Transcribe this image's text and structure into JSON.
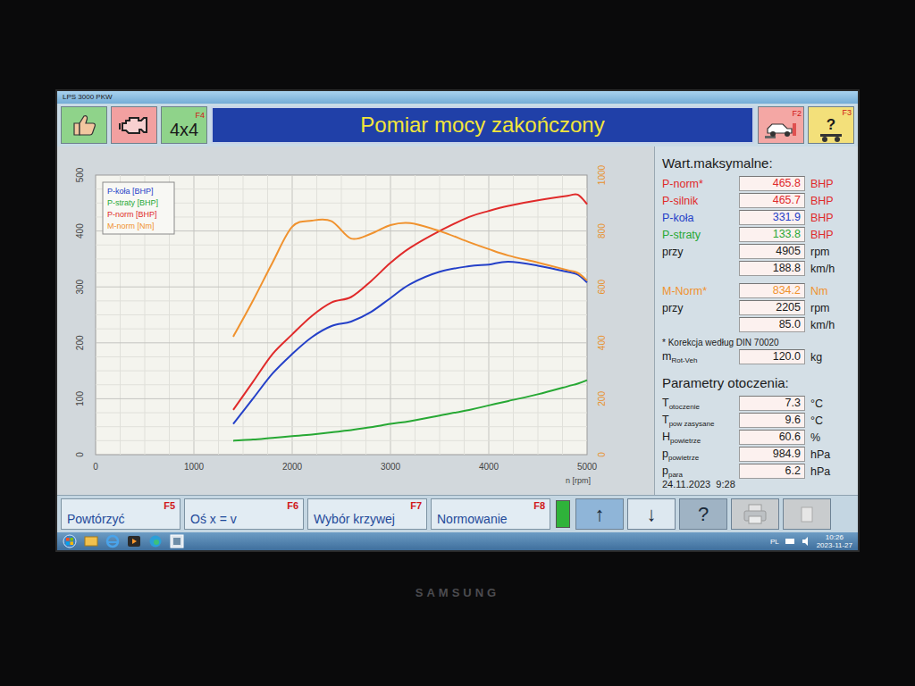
{
  "monitor": {
    "brand": "SAMSUNG"
  },
  "window": {
    "title": "LPS 3000 PKW"
  },
  "toolbar": {
    "left_buttons": [
      {
        "kind": "thumbs-up",
        "color": "#8fd38a"
      },
      {
        "kind": "engine",
        "color": "#f2a0a0"
      },
      {
        "kind": "text",
        "text": "4x4",
        "key": "F4",
        "color": "#8fd38a"
      }
    ],
    "title": "Pomiar mocy zakończony",
    "right_buttons": [
      {
        "kind": "car",
        "key": "F2",
        "color": "#f4a7a4"
      },
      {
        "kind": "help",
        "glyph": "?",
        "key": "F3",
        "color": "#f3e07a"
      }
    ]
  },
  "chart": {
    "x_ticks": [
      "0",
      "1000",
      "2000",
      "3000",
      "4000",
      "5000"
    ],
    "x_unit": "n [rpm]",
    "left_ticks": [
      "0",
      "100",
      "200",
      "300",
      "400",
      "500"
    ],
    "right_ticks": [
      "0",
      "200",
      "400",
      "600",
      "800",
      "1000"
    ],
    "rpm": [
      1400,
      1600,
      1800,
      2000,
      2200,
      2400,
      2600,
      2800,
      3000,
      3200,
      3500,
      3800,
      4000,
      4200,
      4500,
      4800,
      4905,
      5000
    ],
    "series": [
      {
        "label": "P-koła [BHP]",
        "color": "#2440c8",
        "axis": "left",
        "values": [
          55,
          100,
          145,
          180,
          210,
          230,
          238,
          255,
          280,
          305,
          327,
          337,
          340,
          345,
          338,
          327,
          322,
          308
        ]
      },
      {
        "label": "P-straty [BHP]",
        "color": "#27a834",
        "axis": "left",
        "values": [
          25,
          27,
          30,
          33,
          36,
          40,
          44,
          49,
          55,
          60,
          70,
          80,
          88,
          96,
          108,
          122,
          127,
          133
        ]
      },
      {
        "label": "P-norm [BHP]",
        "color": "#e02a2a",
        "axis": "left",
        "values": [
          80,
          130,
          180,
          215,
          248,
          272,
          282,
          310,
          343,
          370,
          400,
          425,
          436,
          445,
          455,
          463,
          465,
          448
        ]
      },
      {
        "label": "M-norm [Nm]",
        "color": "#f0922e",
        "axis": "right",
        "values": [
          422,
          550,
          687,
          815,
          837,
          835,
          773,
          790,
          821,
          828,
          800,
          760,
          735,
          712,
          687,
          660,
          650,
          623
        ]
      }
    ]
  },
  "max_values": {
    "title": "Wart.maksymalne:",
    "power_rows": [
      {
        "label": "P-norm*",
        "value": "465.8",
        "unit": "BHP",
        "color": "#e02a2a",
        "unit_color": "#e02a2a"
      },
      {
        "label": "P-silnik",
        "value": "465.7",
        "unit": "BHP",
        "color": "#e02a2a",
        "unit_color": "#e02a2a"
      },
      {
        "label": "P-koła",
        "value": "331.9",
        "unit": "BHP",
        "color": "#2440c8",
        "unit_color": "#e02a2a"
      },
      {
        "label": "P-straty",
        "value": "133.8",
        "unit": "BHP",
        "color": "#27a834",
        "unit_color": "#e02a2a"
      },
      {
        "label": "przy",
        "value": "4905",
        "unit": "rpm",
        "color": "#1a1a1a",
        "unit_color": "#1a1a1a"
      },
      {
        "value": "188.8",
        "unit": "km/h",
        "color": "#1a1a1a",
        "unit_color": "#1a1a1a"
      }
    ],
    "torque_rows": [
      {
        "label": "M-Norm*",
        "value": "834.2",
        "unit": "Nm",
        "color": "#f0922e",
        "unit_color": "#f0922e"
      },
      {
        "label": "przy",
        "value": "2205",
        "unit": "rpm",
        "color": "#1a1a1a",
        "unit_color": "#1a1a1a"
      },
      {
        "value": "85.0",
        "unit": "km/h",
        "color": "#1a1a1a",
        "unit_color": "#1a1a1a"
      }
    ],
    "note": "* Korekcja według DIN 70020",
    "mass": {
      "symbol": "m",
      "sub": "Rot-Veh",
      "value": "120.0",
      "unit": "kg"
    }
  },
  "ambient": {
    "title": "Parametry otoczenia:",
    "rows": [
      {
        "symbol": "T",
        "sub": "otoczenie",
        "value": "7.3",
        "unit": "°C"
      },
      {
        "symbol": "T",
        "sub": "pow zasysane",
        "value": "9.6",
        "unit": "°C"
      },
      {
        "symbol": "H",
        "sub": "powietrze",
        "value": "60.6",
        "unit": "%"
      },
      {
        "symbol": "p",
        "sub": "powietrze",
        "value": "984.9",
        "unit": "hPa"
      },
      {
        "symbol": "p",
        "sub": "para",
        "value": "6.2",
        "unit": "hPa"
      }
    ]
  },
  "timestamp": "24.11.2023  9:28",
  "function_keys": [
    {
      "label": "Powtórzyć",
      "key": "F5"
    },
    {
      "label": "Oś x = v",
      "key": "F6"
    },
    {
      "label": "Wybór krzywej",
      "key": "F7"
    },
    {
      "label": "Normowanie",
      "key": "F8"
    }
  ],
  "icon_buttons": [
    {
      "kind": "meter",
      "level": 1,
      "disabled": false
    },
    {
      "kind": "glyph",
      "glyph": "↑",
      "disabled": false
    },
    {
      "kind": "glyph",
      "glyph": "↓",
      "disabled": false
    },
    {
      "kind": "glyph",
      "glyph": "?",
      "disabled": false
    },
    {
      "kind": "printer",
      "disabled": true
    },
    {
      "kind": "blank",
      "disabled": true
    }
  ],
  "taskbar": {
    "language": "PL",
    "time": "10:26",
    "date": "2023-11-27"
  }
}
